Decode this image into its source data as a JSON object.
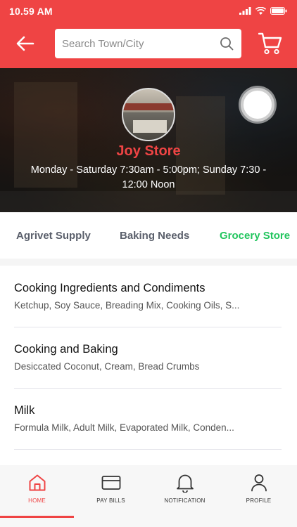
{
  "status": {
    "time": "10.59 AM"
  },
  "header": {
    "search_placeholder": "Search Town/City",
    "icons": {
      "back": "arrow-left-icon",
      "search": "search-icon",
      "cart": "cart-icon"
    }
  },
  "store": {
    "name": "Joy Store",
    "hours": "Monday - Saturday 7:30am - 5:00pm; Sunday 7:30 - 12:00 Noon"
  },
  "tabs": [
    {
      "label": "Agrivet Supply",
      "active": false
    },
    {
      "label": "Baking Needs",
      "active": false
    },
    {
      "label": "Grocery Store",
      "active": true
    }
  ],
  "categories": [
    {
      "title": "Cooking Ingredients and Condiments",
      "items": "Ketchup, Soy Sauce, Breading Mix, Cooking Oils, S..."
    },
    {
      "title": "Cooking and Baking",
      "items": "Desiccated Coconut, Cream, Bread Crumbs"
    },
    {
      "title": "Milk",
      "items": "Formula Milk, Adult Milk, Evaporated Milk, Conden..."
    }
  ],
  "bottom_nav": [
    {
      "label": "HOME",
      "icon": "home-icon",
      "active": true
    },
    {
      "label": "PAY BILLS",
      "icon": "card-icon",
      "active": false
    },
    {
      "label": "NOTIFICATION",
      "icon": "bell-icon",
      "active": false
    },
    {
      "label": "PROFILE",
      "icon": "user-icon",
      "active": false
    }
  ],
  "colors": {
    "brand": "#ef4444",
    "active_tab": "#22c55e",
    "text_muted": "#5a5f6b"
  }
}
